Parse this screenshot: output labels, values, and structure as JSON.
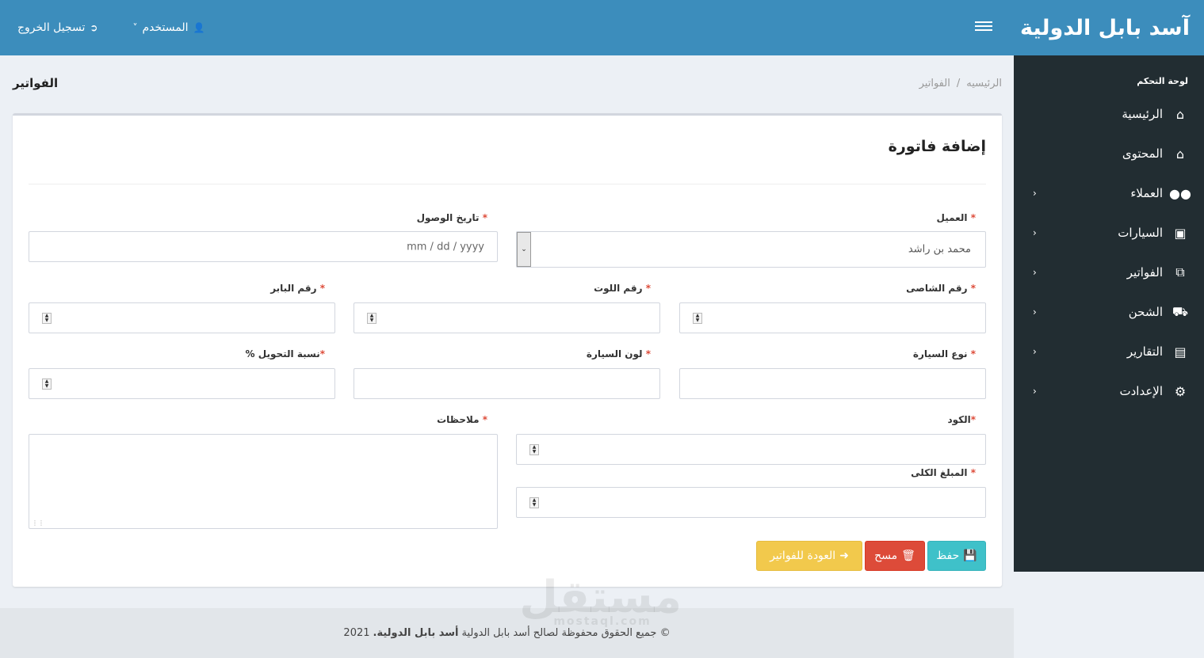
{
  "brand": "آسد بابل الدولية",
  "topnav": {
    "user_label": "المستخدم",
    "logout_label": "تسجيل الخروج"
  },
  "sidebar": {
    "header": "لوحة التحكم",
    "items": [
      {
        "label": "الرئيسية",
        "icon": "home-icon",
        "has_children": false
      },
      {
        "label": "المحتوى",
        "icon": "home-icon",
        "has_children": false
      },
      {
        "label": "العملاء",
        "icon": "users-icon",
        "has_children": true
      },
      {
        "label": "السيارات",
        "icon": "car-icon",
        "has_children": true
      },
      {
        "label": "الفواتير",
        "icon": "copy-icon",
        "has_children": true
      },
      {
        "label": "الشحن",
        "icon": "truck-icon",
        "has_children": true
      },
      {
        "label": "التقارير",
        "icon": "clipboard-icon",
        "has_children": true
      },
      {
        "label": "الإعدادت",
        "icon": "gear-icon",
        "has_children": true
      }
    ]
  },
  "content_header": {
    "title": "الفواتير",
    "breadcrumb": [
      "الرئيسيه",
      "/",
      "الفواتير"
    ]
  },
  "form": {
    "title": "إضافة فاتورة",
    "fields": {
      "customer": {
        "label": "العميل",
        "value": "محمد بن راشد"
      },
      "arrival_date": {
        "label": "تاريخ الوصول",
        "placeholder": "mm / dd / yyyy"
      },
      "chassis": {
        "label": "رقم الشاصى"
      },
      "lot": {
        "label": "رقم اللوت"
      },
      "buyer": {
        "label": "رقم البابر"
      },
      "car_type": {
        "label": "نوع السيارة"
      },
      "car_color": {
        "label": "لون السيارة"
      },
      "conversion_rate": {
        "label": "نسبة التحويل %"
      },
      "code": {
        "label": "الكود"
      },
      "notes": {
        "label": "ملاحظات"
      },
      "total": {
        "label": "المبلغ الكلى"
      }
    },
    "buttons": {
      "save": "حفظ",
      "delete": "مسح",
      "back": "العودة للفواتير"
    }
  },
  "footer": {
    "prefix": "© جميع الحقوق محفوظة لصالح أسد بابل الدولية",
    "company": "أسد بابل الدولية.",
    "year": "2021"
  },
  "watermark": {
    "text": "مستقل",
    "sub": "mostaql.com"
  },
  "colors": {
    "topbar": "#3c8dbc",
    "sidebar": "#222d32",
    "save": "#3fc1c9",
    "delete": "#dd4b39",
    "back": "#f2c94c",
    "required": "#dd4b39"
  }
}
